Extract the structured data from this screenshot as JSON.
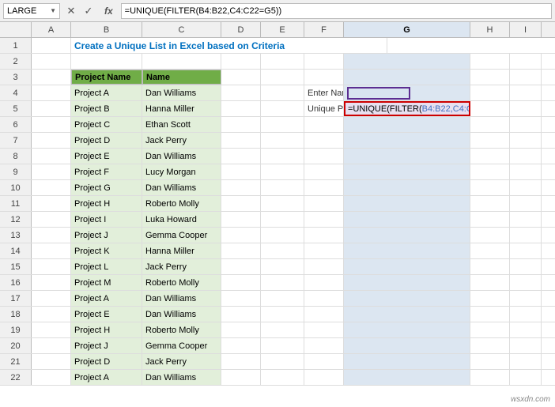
{
  "formulaBar": {
    "nameBox": "LARGE",
    "cancelBtn": "✕",
    "confirmBtn": "✓",
    "functionIcon": "fx",
    "formula": "=UNIQUE(FILTER(B4:B22,C4:C22=G5))"
  },
  "columns": [
    "",
    "A",
    "B",
    "C",
    "D",
    "E",
    "F",
    "G",
    "H",
    "I"
  ],
  "rows": [
    {
      "num": "1",
      "A": "",
      "B": "Create a Unique List in Excel based on Criteria",
      "C": "",
      "D": "",
      "E": "",
      "F": "",
      "G": "",
      "H": "",
      "I": "",
      "style": "title"
    },
    {
      "num": "2",
      "A": "",
      "B": "",
      "C": "",
      "D": "",
      "E": "",
      "F": "",
      "G": "",
      "H": "",
      "I": ""
    },
    {
      "num": "3",
      "A": "",
      "B": "Project Name",
      "C": "Name",
      "D": "",
      "E": "",
      "F": "",
      "G": "",
      "H": "",
      "I": "",
      "style": "header"
    },
    {
      "num": "4",
      "A": "",
      "B": "Project A",
      "C": "Dan Williams",
      "D": "",
      "E": "",
      "F": "Enter Name >>>",
      "G": "",
      "H": "",
      "I": ""
    },
    {
      "num": "5",
      "A": "",
      "B": "Project B",
      "C": "Hanna Miller",
      "D": "",
      "E": "",
      "F": "Unique Project List",
      "G": "=UNIQUE(FILTER(B4:B22,C4:C22=G5))",
      "H": "",
      "I": "",
      "style": "formula-row"
    },
    {
      "num": "6",
      "A": "",
      "B": "Project C",
      "C": "Ethan Scott",
      "D": "",
      "E": "",
      "F": "",
      "G": "",
      "H": "",
      "I": ""
    },
    {
      "num": "7",
      "A": "",
      "B": "Project D",
      "C": "Jack Perry",
      "D": "",
      "E": "",
      "F": "",
      "G": "",
      "H": "",
      "I": ""
    },
    {
      "num": "8",
      "A": "",
      "B": "Project E",
      "C": "Dan Williams",
      "D": "",
      "E": "",
      "F": "",
      "G": "",
      "H": "",
      "I": ""
    },
    {
      "num": "9",
      "A": "",
      "B": "Project F",
      "C": "Lucy Morgan",
      "D": "",
      "E": "",
      "F": "",
      "G": "",
      "H": "",
      "I": ""
    },
    {
      "num": "10",
      "A": "",
      "B": "Project G",
      "C": "Dan Williams",
      "D": "",
      "E": "",
      "F": "",
      "G": "",
      "H": "",
      "I": ""
    },
    {
      "num": "11",
      "A": "",
      "B": "Project H",
      "C": "Roberto Molly",
      "D": "",
      "E": "",
      "F": "",
      "G": "",
      "H": "",
      "I": ""
    },
    {
      "num": "12",
      "A": "",
      "B": "Project I",
      "C": "Luka Howard",
      "D": "",
      "E": "",
      "F": "",
      "G": "",
      "H": "",
      "I": ""
    },
    {
      "num": "13",
      "A": "",
      "B": "Project J",
      "C": "Gemma Cooper",
      "D": "",
      "E": "",
      "F": "",
      "G": "",
      "H": "",
      "I": ""
    },
    {
      "num": "14",
      "A": "",
      "B": "Project K",
      "C": "Hanna Miller",
      "D": "",
      "E": "",
      "F": "",
      "G": "",
      "H": "",
      "I": ""
    },
    {
      "num": "15",
      "A": "",
      "B": "Project L",
      "C": "Jack Perry",
      "D": "",
      "E": "",
      "F": "",
      "G": "",
      "H": "",
      "I": ""
    },
    {
      "num": "16",
      "A": "",
      "B": "Project M",
      "C": "Roberto Molly",
      "D": "",
      "E": "",
      "F": "",
      "G": "",
      "H": "",
      "I": ""
    },
    {
      "num": "17",
      "A": "",
      "B": "Project A",
      "C": "Dan Williams",
      "D": "",
      "E": "",
      "F": "",
      "G": "",
      "H": "",
      "I": ""
    },
    {
      "num": "18",
      "A": "",
      "B": "Project E",
      "C": "Dan Williams",
      "D": "",
      "E": "",
      "F": "",
      "G": "",
      "H": "",
      "I": ""
    },
    {
      "num": "19",
      "A": "",
      "B": "Project H",
      "C": "Roberto Molly",
      "D": "",
      "E": "",
      "F": "",
      "G": "",
      "H": "",
      "I": ""
    },
    {
      "num": "20",
      "A": "",
      "B": "Project J",
      "C": "Gemma Cooper",
      "D": "",
      "E": "",
      "F": "",
      "G": "",
      "H": "",
      "I": ""
    },
    {
      "num": "21",
      "A": "",
      "B": "Project D",
      "C": "Jack Perry",
      "D": "",
      "E": "",
      "F": "",
      "G": "",
      "H": "",
      "I": ""
    },
    {
      "num": "22",
      "A": "",
      "B": "Project A",
      "C": "Dan Williams",
      "D": "",
      "E": "",
      "F": "",
      "G": "",
      "H": "",
      "I": ""
    }
  ],
  "watermark": "wsxdn.com"
}
